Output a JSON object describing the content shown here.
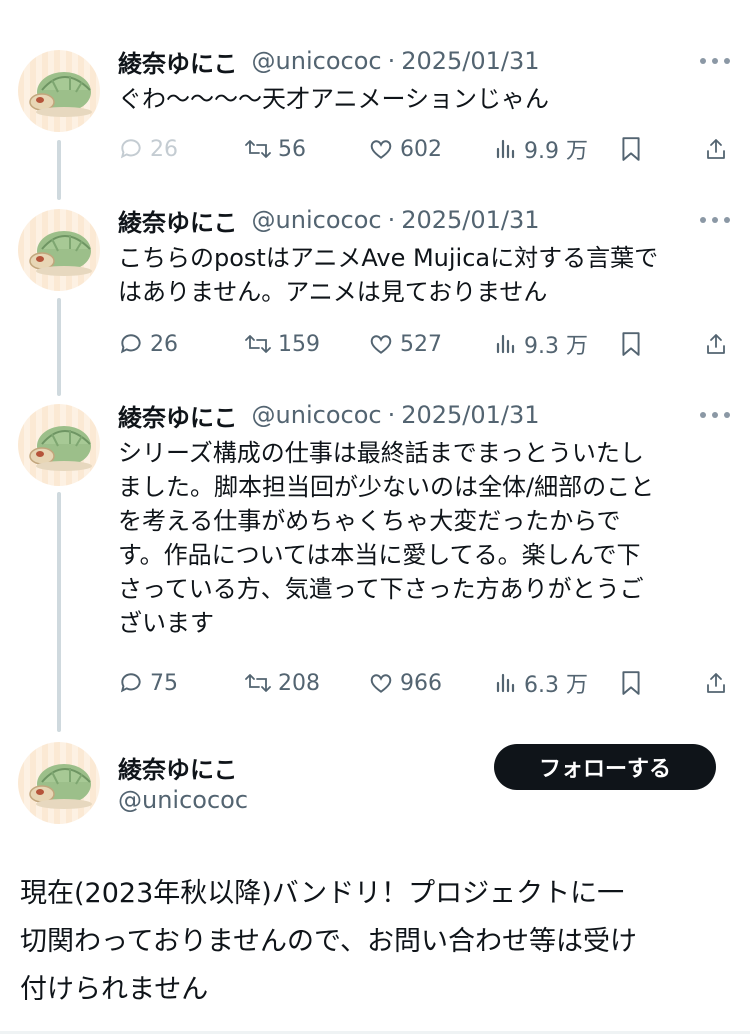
{
  "tweets": [
    {
      "author": "綾奈ゆにこ",
      "handle": "@unicococ",
      "separator": "·",
      "date": "2025/01/31",
      "lines": [
        "ぐわ〜〜〜〜天才アニメーションじゃん"
      ],
      "replies": "26",
      "reposts": "56",
      "likes": "602",
      "views": "9.9 万"
    },
    {
      "author": "綾奈ゆにこ",
      "handle": "@unicococ",
      "separator": "·",
      "date": "2025/01/31",
      "lines": [
        "こちらのpostはアニメAve Mujicaに対する言葉で",
        "はありません。アニメは見ておりません"
      ],
      "replies": "26",
      "reposts": "159",
      "likes": "527",
      "views": "9.3 万"
    },
    {
      "author": "綾奈ゆにこ",
      "handle": "@unicococ",
      "separator": "·",
      "date": "2025/01/31",
      "lines": [
        "シリーズ構成の仕事は最終話までまっとういたし",
        "ました。脚本担当回が少ないのは全体/細部のこと",
        "を考える仕事がめちゃくちゃ大変だったからで",
        "す。作品については本当に愛してる。楽しんで下",
        "さっている方、気遣って下さった方ありがとうご",
        "ざいます"
      ],
      "replies": "75",
      "reposts": "208",
      "likes": "966",
      "views": "6.3 万"
    }
  ],
  "profile": {
    "name": "綾奈ゆにこ",
    "handle": "@unicococ",
    "follow_label": "フォローする",
    "bio_lines": [
      "現在(2023年秋以降)バンドリ！プロジェクトに一",
      "切関わっておりませんので、お問い合わせ等は受け",
      "付けられません"
    ]
  },
  "icons": {
    "reply": "reply-icon",
    "repost": "repost-icon",
    "like": "heart-icon",
    "views": "views-icon",
    "bookmark": "bookmark-icon",
    "share": "share-icon",
    "more": "more-icon"
  },
  "colors": {
    "text": "#0f1419",
    "secondary": "#536471",
    "follow_button_bg": "#0f1419",
    "thread_line": "#cfd9de"
  }
}
